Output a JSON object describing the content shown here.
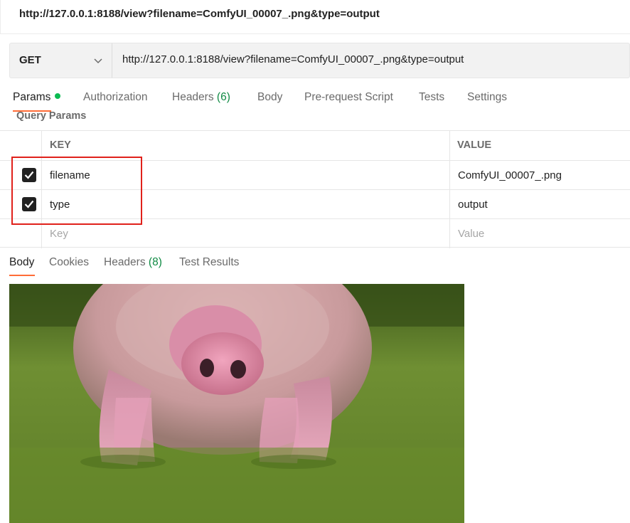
{
  "window": {
    "title": "http://127.0.0.1:8188/view?filename=ComfyUI_00007_.png&type=output"
  },
  "request": {
    "method": "GET",
    "url": "http://127.0.0.1:8188/view?filename=ComfyUI_00007_.png&type=output"
  },
  "request_tabs": {
    "params": "Params",
    "authorization": "Authorization",
    "headers": "Headers",
    "headers_count": "(6)",
    "body": "Body",
    "pre_request": "Pre-request Script",
    "tests": "Tests",
    "settings": "Settings"
  },
  "query_params": {
    "section_label": "Query Params",
    "key_header": "KEY",
    "value_header": "VALUE",
    "rows": [
      {
        "key": "filename",
        "value": "ComfyUI_00007_.png",
        "checked": true
      },
      {
        "key": "type",
        "value": "output",
        "checked": true
      }
    ],
    "key_placeholder": "Key",
    "value_placeholder": "Value"
  },
  "response_tabs": {
    "body": "Body",
    "cookies": "Cookies",
    "headers": "Headers",
    "headers_count": "(8)",
    "test_results": "Test Results"
  },
  "colors": {
    "accent": "#ff6c37",
    "status_green": "#0cbb52",
    "highlight_red": "#e0211b"
  }
}
